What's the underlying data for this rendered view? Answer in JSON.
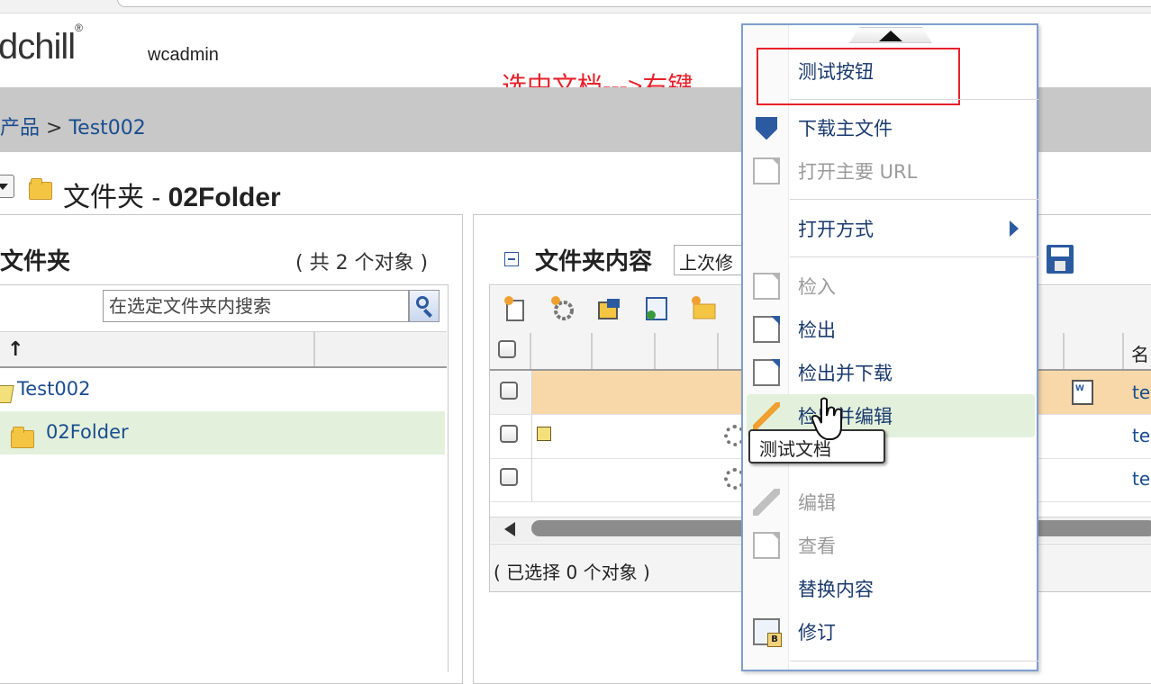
{
  "header": {
    "logo_text": "dchill",
    "logo_mark": "®",
    "username": "wcadmin"
  },
  "annotation": {
    "text": "选中文档--->右键",
    "color": "#e8202a"
  },
  "breadcrumb": {
    "parent": "产品",
    "separator": ">",
    "current": "Test002"
  },
  "page": {
    "title_prefix": "文件夹 - ",
    "title_name": "02Folder"
  },
  "left_panel": {
    "title": "文件夹",
    "count": "( 共 2 个对象 )",
    "search_placeholder": "在选定文件夹内搜索",
    "sort_glyph": "↑",
    "tree": [
      {
        "label": "Test002"
      },
      {
        "label": "02Folder",
        "selected": true
      }
    ]
  },
  "right_panel": {
    "title": "文件夹内容",
    "view_select_value": "上次修",
    "name_column_header": "名",
    "row_names": [
      "tes",
      "tes",
      "tes"
    ],
    "selected_status": "( 已选择 0 个对象 )"
  },
  "context_menu": {
    "items": [
      {
        "label": "测试按钮",
        "icon": "none",
        "disabled": false
      },
      {
        "label": "下载主文件",
        "icon": "download-icon",
        "disabled": false
      },
      {
        "label": "打开主要 URL",
        "icon": "open-url-icon",
        "disabled": true
      },
      {
        "label": "打开方式",
        "icon": "none",
        "disabled": false,
        "submenu": true
      },
      {
        "label": "检入",
        "icon": "check-in-icon",
        "disabled": true
      },
      {
        "label": "检出",
        "icon": "check-out-icon",
        "disabled": false
      },
      {
        "label": "检出并下载",
        "icon": "check-out-download-icon",
        "disabled": false
      },
      {
        "label": "检出并编辑",
        "icon": "check-out-edit-icon",
        "disabled": false,
        "hovered": true
      },
      {
        "label": "编辑",
        "icon": "edit-icon",
        "disabled": true
      },
      {
        "label": "查看",
        "icon": "view-icon",
        "disabled": true
      },
      {
        "label": "替换内容",
        "icon": "none",
        "disabled": false
      },
      {
        "label": "修订",
        "icon": "revise-icon",
        "disabled": false
      }
    ]
  },
  "tooltip": {
    "text": "测试文档"
  },
  "colors": {
    "accent": "#1a4d8f",
    "selected_row": "#f8d8a8",
    "tree_selected": "#e3f1dc",
    "menu_border": "#7f9ed0",
    "highlight_box": "#e8202a"
  }
}
